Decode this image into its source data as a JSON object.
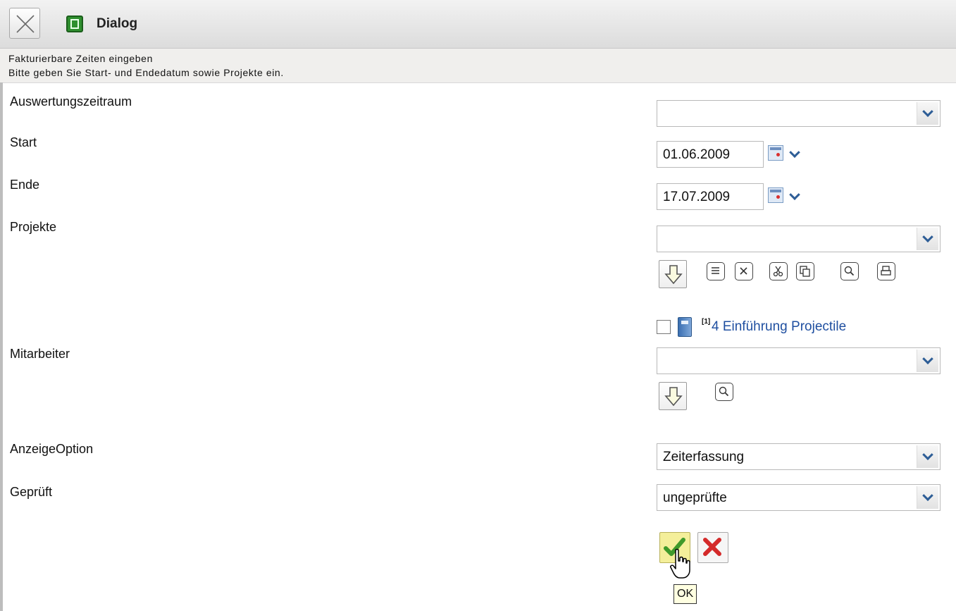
{
  "window": {
    "title": "Dialog",
    "close_icon": "close-icon",
    "dialog_icon": "dialog-icon"
  },
  "info": {
    "line1": "Fakturierbare Zeiten eingeben",
    "line2": "Bitte geben Sie Start- und Endedatum sowie Projekte ein."
  },
  "form": {
    "auswertungszeitraum": {
      "label": "Auswertungszeitraum",
      "value": ""
    },
    "start": {
      "label": "Start",
      "value": "01.06.2009"
    },
    "ende": {
      "label": "Ende",
      "value": "17.07.2009"
    },
    "projekte": {
      "label": "Projekte",
      "value": "",
      "tools": [
        "add-down-icon",
        "list-icon",
        "delete-icon",
        "cut-icon",
        "copy-icon",
        "search-icon",
        "print-icon"
      ],
      "items": [
        {
          "index": "[1]",
          "name": "4 Einführung Projectile",
          "checked": false
        }
      ]
    },
    "mitarbeiter": {
      "label": "Mitarbeiter",
      "value": "",
      "tools": [
        "add-down-icon",
        "search-icon"
      ]
    },
    "anzeigeoption": {
      "label": "AnzeigeOption",
      "value": "Zeiterfassung"
    },
    "geprueft": {
      "label": "Geprüft",
      "value": "ungeprüfte"
    }
  },
  "actions": {
    "ok_icon": "checkmark-icon",
    "cancel_icon": "red-x-icon",
    "ok_tooltip": "OK"
  },
  "colors": {
    "link": "#1f4fa0",
    "ok_bg": "#f4ef9a",
    "dropdown_arrow": "#2d5d96"
  }
}
